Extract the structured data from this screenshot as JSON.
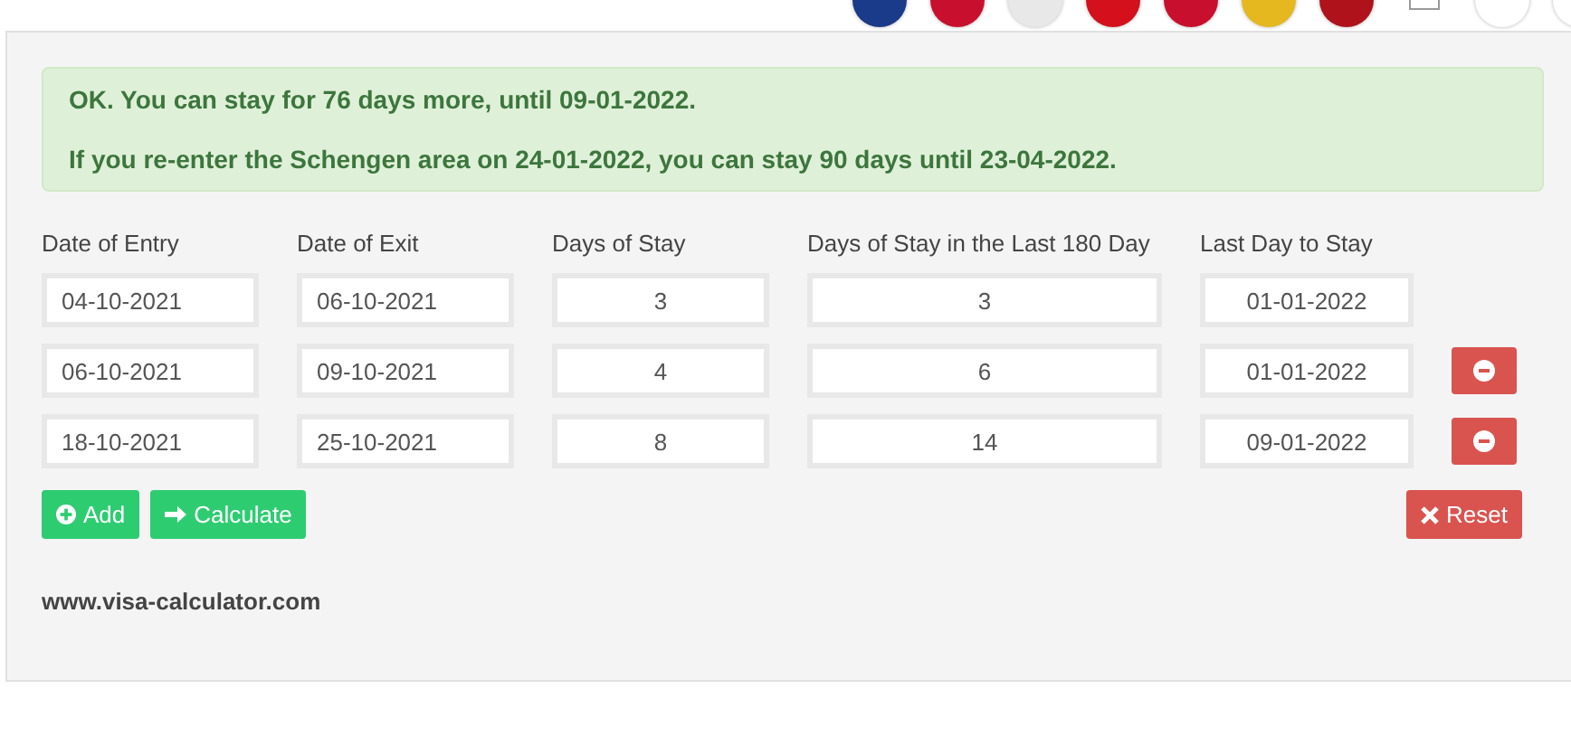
{
  "alert": {
    "lines": [
      "OK. You can stay for 76 days more, until 09-01-2022.",
      "If you re-enter the Schengen area on 24-01-2022, you can stay 90 days until 23-04-2022."
    ]
  },
  "table": {
    "columns": [
      "Date of Entry",
      "Date of Exit",
      "Days of Stay",
      "Days of Stay in the Last 180 Day",
      "Last Day to Stay"
    ],
    "rows": [
      {
        "entry": "04-10-2021",
        "exit": "06-10-2021",
        "days": "3",
        "last180": "3",
        "last_day": "01-01-2022",
        "removable": false
      },
      {
        "entry": "06-10-2021",
        "exit": "09-10-2021",
        "days": "4",
        "last180": "6",
        "last_day": "01-01-2022",
        "removable": true
      },
      {
        "entry": "18-10-2021",
        "exit": "25-10-2021",
        "days": "8",
        "last180": "14",
        "last_day": "09-01-2022",
        "removable": true
      }
    ]
  },
  "buttons": {
    "add": "Add",
    "calculate": "Calculate",
    "reset": "Reset"
  },
  "footer": "www.visa-calculator.com"
}
